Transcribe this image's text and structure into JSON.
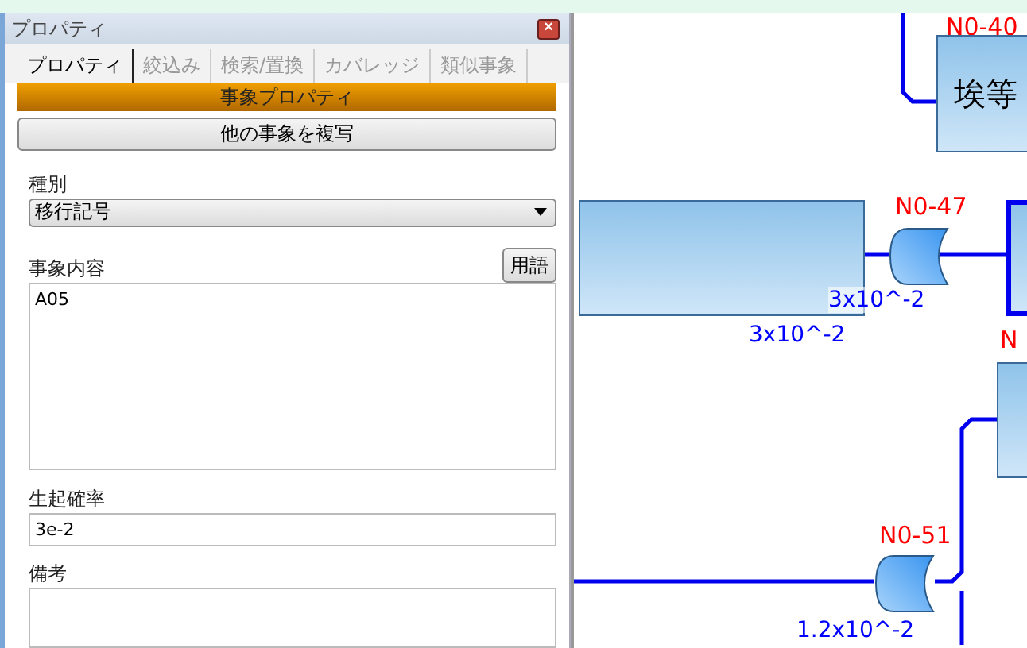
{
  "panel": {
    "title": "プロパティ",
    "close": "×"
  },
  "tabs": [
    {
      "label": "プロパティ",
      "selected": true
    },
    {
      "label": "絞込み",
      "selected": false
    },
    {
      "label": "検索/置換",
      "selected": false
    },
    {
      "label": "カバレッジ",
      "selected": false
    },
    {
      "label": "類似事象",
      "selected": false
    }
  ],
  "section_header": "事象プロパティ",
  "copy_button": "他の事象を複写",
  "type_field": {
    "label": "種別",
    "value": "移行記号"
  },
  "content_field": {
    "label": "事象内容",
    "terms_button": "用語",
    "value": "A05"
  },
  "probability_field": {
    "label": "生起確率",
    "value": "3e-2"
  },
  "notes_field": {
    "label": "備考"
  },
  "canvas": {
    "items": [
      {
        "kind": "label",
        "text": "N0-40"
      },
      {
        "kind": "box",
        "text": "埃等",
        "bold": false
      },
      {
        "kind": "box",
        "bold": false
      },
      {
        "kind": "label",
        "text": "N0-47"
      },
      {
        "kind": "gate"
      },
      {
        "kind": "box",
        "bold": true
      },
      {
        "kind": "value",
        "text": "3x10^-2"
      },
      {
        "kind": "value",
        "text": "3x10^-2"
      },
      {
        "kind": "label",
        "text": "N"
      },
      {
        "kind": "box",
        "bold": false
      },
      {
        "kind": "label",
        "text": "N0-51"
      },
      {
        "kind": "gate"
      },
      {
        "kind": "value",
        "text": "1.2x10^-2"
      }
    ]
  }
}
